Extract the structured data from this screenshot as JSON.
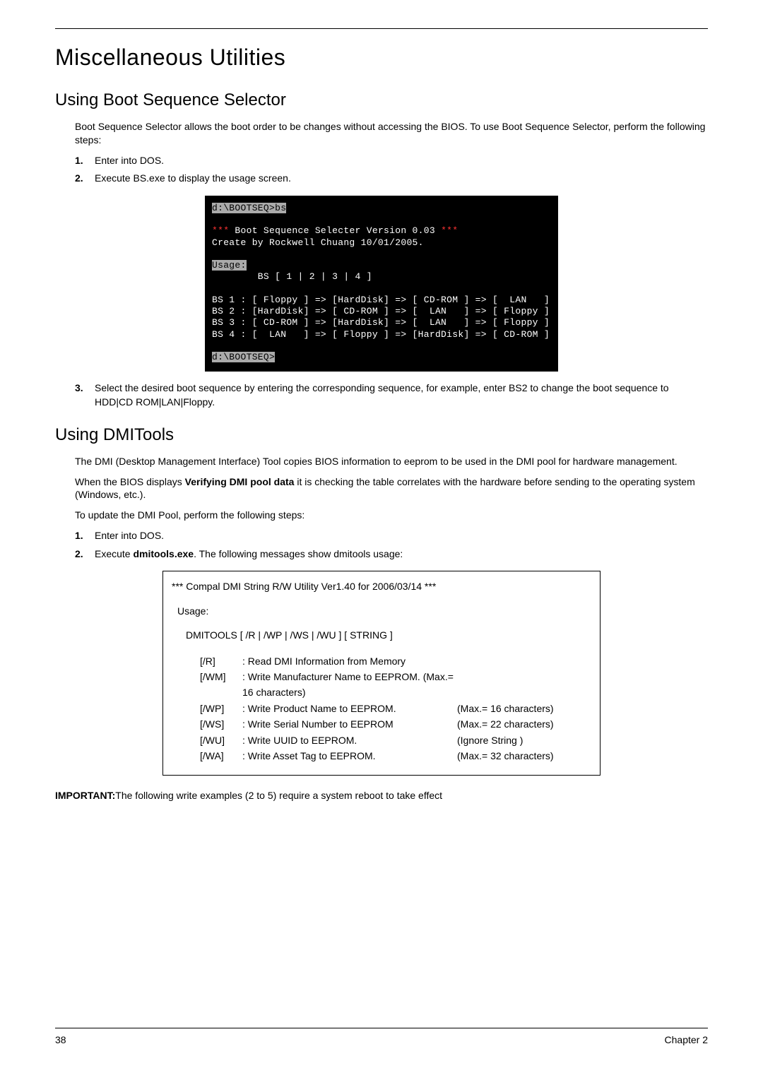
{
  "h1": "Miscellaneous Utilities",
  "section1": {
    "title": "Using Boot Sequence Selector",
    "intro": "Boot Sequence Selector allows the boot order to be changes without accessing the BIOS. To use Boot Sequence Selector, perform the following steps:",
    "steps": {
      "n1": "1.",
      "s1": "Enter into DOS.",
      "n2": "2.",
      "s2": "Execute BS.exe to display the usage screen.",
      "n3": "3.",
      "s3": "Select the desired boot sequence by entering the corresponding sequence, for example, enter BS2 to change the boot sequence to HDD|CD ROM|LAN|Floppy."
    },
    "terminal": {
      "l1": "d:\\BOOTSEQ>bs",
      "l2a": "***",
      "l2b": " Boot Sequence Selecter Version 0.03 ",
      "l2c": "***",
      "l3": "Create by Rockwell Chuang 10/01/2005.",
      "l4": "Usage:",
      "l5": "        BS [ 1 | 2 | 3 | 4 ]",
      "l6": "BS 1 : [ Floppy ] => [HardDisk] => [ CD-ROM ] => [  LAN   ]",
      "l7": "BS 2 : [HardDisk] => [ CD-ROM ] => [  LAN   ] => [ Floppy ]",
      "l8": "BS 3 : [ CD-ROM ] => [HardDisk] => [  LAN   ] => [ Floppy ]",
      "l9": "BS 4 : [  LAN   ] => [ Floppy ] => [HardDisk] => [ CD-ROM ]",
      "l10": "d:\\BOOTSEQ>"
    }
  },
  "section2": {
    "title": "Using DMITools",
    "p1": "The DMI (Desktop Management Interface) Tool copies BIOS information to eeprom to be used in the DMI pool for hardware management.",
    "p2a": "When the BIOS displays ",
    "p2b": "Verifying DMI pool data",
    "p2c": " it is checking the table correlates with the hardware before sending to the operating system (Windows, etc.).",
    "p3": "To update the DMI Pool, perform the following steps:",
    "steps": {
      "n1": "1.",
      "s1": "Enter into DOS.",
      "n2": "2.",
      "s2a": "Execute ",
      "s2b": "dmitools.exe",
      "s2c": ". The following messages show dmitools usage:"
    },
    "box": {
      "title": "*** Compal DMI String R/W Utility Ver1.40 for 2006/03/14 ***",
      "usage": "Usage:",
      "cmd": "DMITOOLS [ /R | /WP | /WS | /WU ] [ STRING ]",
      "rows": [
        {
          "flag": "[/R]",
          "desc": ": Read DMI Information from Memory",
          "max": ""
        },
        {
          "flag": "[/WM]",
          "desc": ": Write Manufacturer Name to EEPROM. (Max.= 16 characters)",
          "max": ""
        },
        {
          "flag": "[/WP]",
          "desc": ": Write Product Name to EEPROM.",
          "max": "(Max.= 16 characters)"
        },
        {
          "flag": "[/WS]",
          "desc": ": Write Serial Number to EEPROM",
          "max": "(Max.= 22 characters)"
        },
        {
          "flag": "[/WU]",
          "desc": ": Write UUID to EEPROM.",
          "max": "(Ignore String          )"
        },
        {
          "flag": "[/WA]",
          "desc": ": Write Asset Tag to EEPROM.",
          "max": "(Max.= 32 characters)"
        }
      ]
    }
  },
  "important": {
    "label": "IMPORTANT:",
    "text": "The following write examples (2 to 5) require a system reboot to take effect"
  },
  "footer": {
    "page": "38",
    "chapter": "Chapter 2"
  }
}
